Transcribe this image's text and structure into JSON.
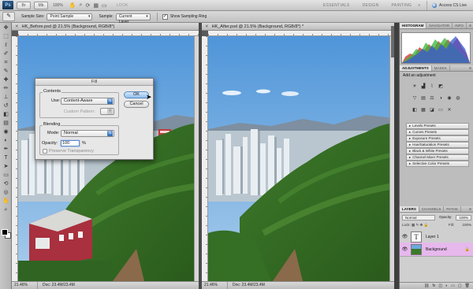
{
  "menubar": {
    "logo": "Ps",
    "icons": [
      "Br",
      "Mb"
    ],
    "zoom": "100%",
    "view_icons": [
      "hand-icon",
      "zoom-icon",
      "rotate-icon",
      "arrange-icon",
      "screen-icon"
    ],
    "mode": "LOOK",
    "workspaces": [
      "ESSENTIALS",
      "DESIGN",
      "PAINTING"
    ],
    "more_label": "»",
    "cs_live": "Access CS Live"
  },
  "options": {
    "sample_size_label": "Sample Size:",
    "sample_size_value": "Point Sample",
    "sample_label": "Sample:",
    "sample_value": "Current Layer",
    "show_ring_label": "Show Sampling Ring",
    "show_ring_checked": "✓"
  },
  "doc_left": {
    "title": "HK_Before.psd @ 21.5% (Background, RGB/8*)",
    "zoom": "21.46%",
    "info": "Doc: 23.4M/23.4M"
  },
  "doc_right": {
    "title": "HK_After.psd @ 21.5% (Background, RGB/8*) *",
    "zoom": "21.46%",
    "info": "Doc: 23.4M/23.4M"
  },
  "dialog": {
    "title": "Fill",
    "contents_group": "Contents",
    "use_label": "Use:",
    "use_value": "Content-Aware",
    "custom_pattern_label": "Custom Pattern:",
    "blending_group": "Blending",
    "mode_label": "Mode:",
    "mode_value": "Normal",
    "opacity_label": "Opacity:",
    "opacity_value": "100",
    "opacity_unit": "%",
    "preserve_label": "Preserve Transparency",
    "ok_label": "OK",
    "cancel_label": "Cancel"
  },
  "panel": {
    "top_tabs": [
      "HISTOGRAM",
      "NAVIGATOR",
      "INFO"
    ],
    "adj_tabs": [
      "ADJUSTMENTS",
      "MASKS"
    ],
    "add_adjustment": "Add an adjustment",
    "presets": [
      "Levels Presets",
      "Curves Presets",
      "Exposure Presets",
      "Hue/Saturation Presets",
      "Black & White Presets",
      "Channel Mixer Presets",
      "Selective Color Presets"
    ],
    "layers_tabs": [
      "LAYERS",
      "CHANNELS",
      "PATHS"
    ],
    "blend_mode": "Normal",
    "opacity_label": "Opacity:",
    "opacity_value": "100%",
    "lock_label": "Lock:",
    "fill_label": "Fill:",
    "fill_value": "100%",
    "layers": [
      {
        "name": "Layer 1",
        "selected": false
      },
      {
        "name": "Background",
        "selected": true
      }
    ],
    "text_thumb": "T"
  },
  "colors": {
    "selected_layer": "#e6b8ec",
    "ok_button": "#8fc0ee"
  }
}
